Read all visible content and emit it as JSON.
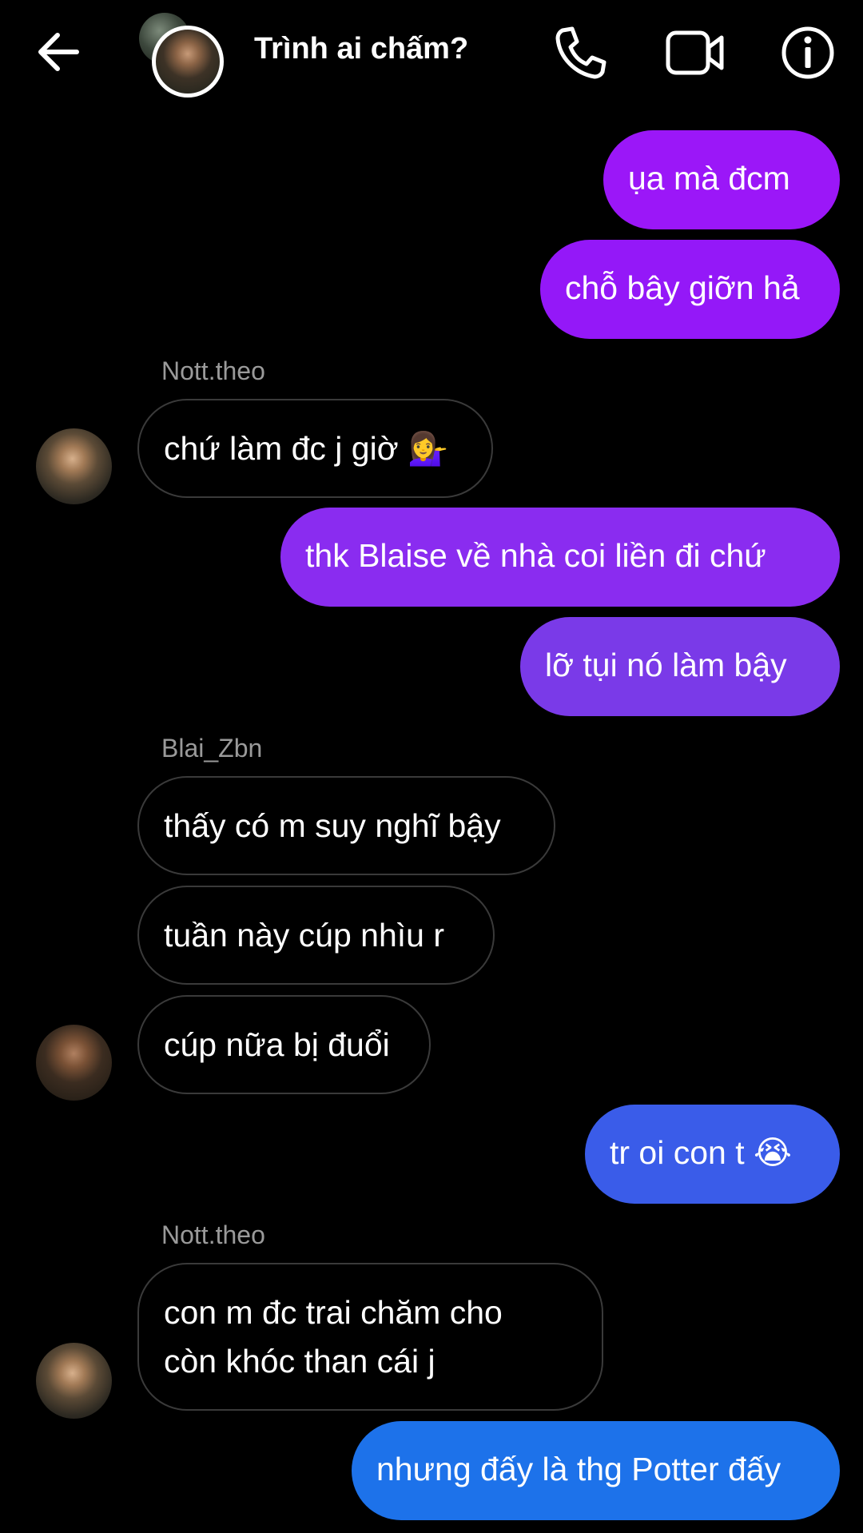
{
  "header": {
    "title": "Trình ai chấm?",
    "back_icon": "arrow-left-icon",
    "call_icon": "phone-icon",
    "video_icon": "video-camera-icon",
    "info_icon": "info-icon"
  },
  "colors": {
    "background": "#000000",
    "incoming_bubble_border": "#3a3a3a",
    "sender_name": "#9a9a9a",
    "outgoing_gradient": [
      "#9b17f8",
      "#8a2cf0",
      "#7a3ae8",
      "#3a5ce9",
      "#1d72ea"
    ]
  },
  "messages": [
    {
      "direction": "out",
      "text": "ụa mà đcm"
    },
    {
      "direction": "out",
      "text": "chỗ bây giỡn hả"
    },
    {
      "direction": "in",
      "sender": "Nott.theo",
      "text": "chứ làm đc j giờ",
      "emoji": "💁‍♀️"
    },
    {
      "direction": "out",
      "text": "thk Blaise về nhà coi liền đi chứ"
    },
    {
      "direction": "out",
      "text": "lỡ tụi nó làm bậy"
    },
    {
      "direction": "in",
      "sender": "Blai_Zbn",
      "text": "thấy có m suy nghĩ bậy"
    },
    {
      "direction": "in",
      "text": "tuần này cúp nhìu r"
    },
    {
      "direction": "in",
      "text": "cúp nữa bị đuổi"
    },
    {
      "direction": "out",
      "text": "tr oi con t",
      "emoji": "😭"
    },
    {
      "direction": "in",
      "sender": "Nott.theo",
      "text_line1": "con m đc trai chăm cho",
      "text_line2": "còn khóc than cái j"
    },
    {
      "direction": "out",
      "text": "nhưng đấy là thg Potter đấy"
    }
  ]
}
